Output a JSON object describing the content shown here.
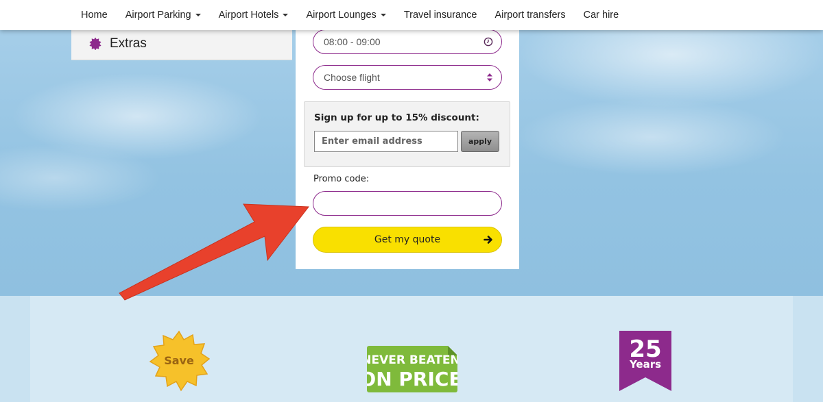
{
  "nav": {
    "items": [
      {
        "label": "Home",
        "dropdown": false
      },
      {
        "label": "Airport Parking",
        "dropdown": true
      },
      {
        "label": "Airport Hotels",
        "dropdown": true
      },
      {
        "label": "Airport Lounges",
        "dropdown": true
      },
      {
        "label": "Travel insurance",
        "dropdown": false
      },
      {
        "label": "Airport transfers",
        "dropdown": false
      },
      {
        "label": "Car hire",
        "dropdown": false
      }
    ]
  },
  "sidebar": {
    "extras_label": "Extras",
    "extras_icon": "badge-icon"
  },
  "form": {
    "time_value": "08:00 - 09:00",
    "time_icon": "clock-icon",
    "flight_placeholder": "Choose flight",
    "flight_icon": "sort-arrows-icon",
    "discount": {
      "title": "Sign up for up to 15% discount:",
      "email_placeholder": "Enter email address",
      "apply_label": "apply"
    },
    "promo_label": "Promo code:",
    "promo_value": "",
    "quote_label": "Get my quote",
    "quote_icon": "arrow-right-icon"
  },
  "badges": {
    "save_text": "Save",
    "price_line1": "NEVER BEATEN",
    "price_line2": "ON PRICE",
    "years_number": "25",
    "years_label": "Years"
  },
  "colors": {
    "accent_purple": "#8d2a8c",
    "quote_yellow": "#f9e000",
    "badge_green": "#7fba3b",
    "save_yellow": "#f6c12a",
    "arrow_red": "#e8412c"
  }
}
